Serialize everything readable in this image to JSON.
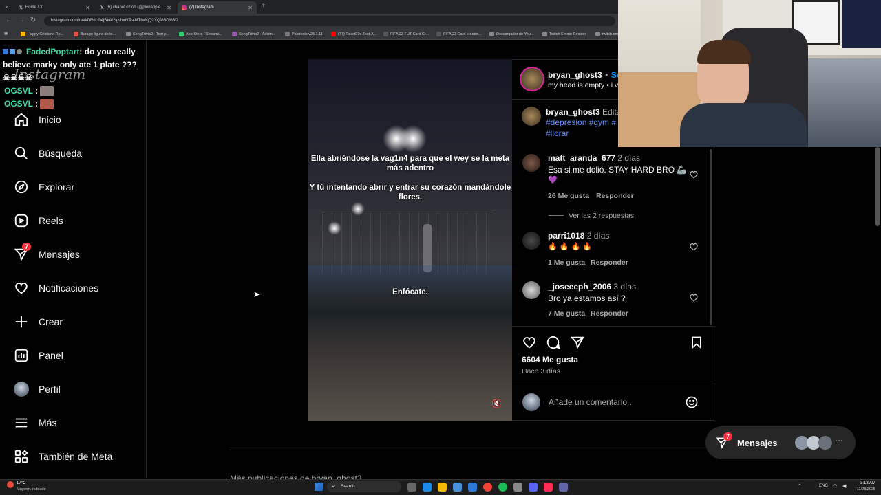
{
  "browser": {
    "tabs": [
      {
        "title": "Home / X",
        "active": false
      },
      {
        "title": "(6) chanel ozion (@pinnapple...",
        "active": false
      },
      {
        "title": "(7) Instagram",
        "active": true
      }
    ],
    "url": "instagram.com/reel/DRdcf04jBkA/?igsh=NTc4MTIwNjQ2YQ%3D%3D",
    "bookmarks": [
      "Happy Cristiano Ro...",
      "Burago figura de lo...",
      "SongTrivia2 - Test y...",
      "App Store / Streami...",
      "SongTrivia2 - Adivin...",
      "Paletools v25.1.11",
      "(77) Racci97s Zest-A...",
      "FIFA 23 FUT Card Cr...",
      "FIFA 23 Card creator...",
      "Descargador de You...",
      "Twitch Emote Resizer",
      "twitch em"
    ]
  },
  "chat_overlay": {
    "line1_user": "FadedPoptart",
    "line1_text": ": do you really believe marky only ate 1 plate ???",
    "line2_user": "OGSVL",
    "line3_user": "OGSVL",
    "sep": ":"
  },
  "sidebar": {
    "logo": "Instagram",
    "items": [
      {
        "label": "Inicio",
        "icon": "home-icon"
      },
      {
        "label": "Búsqueda",
        "icon": "search-icon"
      },
      {
        "label": "Explorar",
        "icon": "compass-icon"
      },
      {
        "label": "Reels",
        "icon": "reels-icon"
      },
      {
        "label": "Mensajes",
        "icon": "messenger-icon",
        "badge": "7"
      },
      {
        "label": "Notificaciones",
        "icon": "heart-icon"
      },
      {
        "label": "Crear",
        "icon": "plus-icon"
      },
      {
        "label": "Panel",
        "icon": "chart-icon"
      },
      {
        "label": "Perfil",
        "icon": "avatar"
      },
      {
        "label": "Más",
        "icon": "menu-icon"
      },
      {
        "label": "También de Meta",
        "icon": "meta-icon"
      }
    ]
  },
  "post": {
    "overlay_text_1": "Ella abriéndose la vag1n4 para que el wey se la meta más adentro",
    "overlay_text_2": "Y tú intentando abrir  y entrar su corazón mandándole flores.",
    "overlay_text_3": "Enfócate.",
    "header": {
      "username": "bryan_ghost3",
      "dot": "•",
      "follow": "Se",
      "subtitle": "my head is empty • i v"
    },
    "caption": {
      "username": "bryan_ghost3",
      "edited": "Edita",
      "hashtags_1": "#depresion #gym #",
      "hashtags_2": "#llorar"
    },
    "comments": [
      {
        "username": "matt_aranda_677",
        "time": "2 días",
        "text": "Esa si me dolió. STAY HARD BRO 🦾",
        "text2": "💜",
        "likes": "26 Me gusta",
        "reply": "Responder",
        "view_replies": "Ver las 2 respuestas"
      },
      {
        "username": "parri1018",
        "time": "2 días",
        "text": "🔥 🔥 🔥 🔥",
        "likes": "1 Me gusta",
        "reply": "Responder"
      },
      {
        "username": "_joseeeph_2006",
        "time": "3 días",
        "text": "Bro ya estamos así ?",
        "likes": "7 Me gusta",
        "reply": "Responder"
      }
    ],
    "like_count": "6604 Me gusta",
    "posted": "Hace 3 días",
    "comment_placeholder": "Añade un comentario..."
  },
  "messages_pill": {
    "label": "Mensajes",
    "badge": "7"
  },
  "below_text": "Más publicaciones de bryan_ghost3",
  "taskbar": {
    "weather_temp": "17°C",
    "weather_desc": "Mayorm. nublado",
    "search": "Search",
    "lang": "ENG",
    "time": "3:13 AM",
    "date": "11/28/2025"
  },
  "colors": {
    "accent_blue": "#0095f6",
    "badge_red": "#ff3040",
    "chat_green": "#3ed7a3",
    "hashtag": "#5b8cff"
  }
}
